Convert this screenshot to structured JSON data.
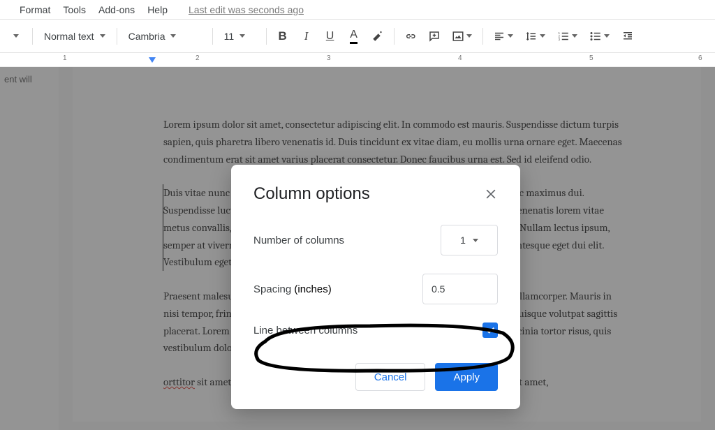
{
  "menu": {
    "format": "Format",
    "tools": "Tools",
    "addons": "Add-ons",
    "help": "Help",
    "edit_status": "Last edit was seconds ago"
  },
  "toolbar": {
    "style": "Normal text",
    "font": "Cambria",
    "size": "11"
  },
  "ruler": {
    "marks": [
      "1",
      "2",
      "3",
      "4",
      "5",
      "6"
    ]
  },
  "outline": {
    "line": "ent will"
  },
  "doc": {
    "p1": "Lorem ipsum dolor sit amet, consectetur adipiscing elit. In commodo est mauris. Suspendisse dictum turpis sapien, quis pharetra libero venenatis id. Duis tincidunt ex vitae diam, eu mollis urna ornare eget. Maecenas condimentum erat sit amet varius placerat consectetur. Donec faucibus urna est. Sed id eleifend odio.",
    "p2": "Duis vitae nunc et lacus ullamcorper rhoncus porttitor massa amet. Pellentesque nec maximus dui. Suspendisse luctus odio, sed consequat ligula ut lectus. Etiam ut gravida est. Proin venenatis lorem vitae metus convallis, a faucibus odio semper. Duis dictum purus elit, quis condimentum. Nullam lectus ipsum, semper at viverra vel, pretium eget ligula. Etiam ultrices eu mollis ipsum ante. Pellentesque eget dui elit. Vestibulum eget.",
    "p3": "Praesent malesuada in odio et gravida. Quisque semper lectus sit amet vestibulum ullamcorper. Mauris in nisi tempor, fringilla neque sed, dignissim risus. Vivamus et pulvinar facilisis erat. Quisque volutpat sagittis placerat. Lorem ipsum dolor sit amet, consectetur urna non, rutrum neque. Proin lacinia tortor risus, quis vestibulum dolor",
    "p4a": "orttitor",
    "p4b": " sit amet. Fusce ultrices metus id eros facilisis eleifend. Lorem ipsum dolor sit amet,"
  },
  "dialog": {
    "title": "Column options",
    "num_cols_label": "Number of columns",
    "num_cols_value": "1",
    "spacing_label_a": "Spacing ",
    "spacing_label_b": "(inches)",
    "spacing_value": "0.5",
    "line_between_label": "Line between columns",
    "line_between_checked": true,
    "cancel": "Cancel",
    "apply": "Apply"
  }
}
